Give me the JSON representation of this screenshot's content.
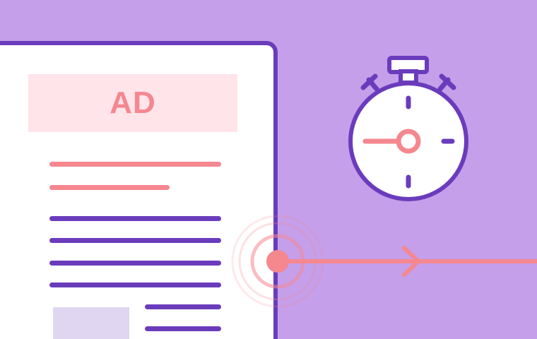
{
  "ad_banner": {
    "label": "AD"
  },
  "icons": {
    "stopwatch": "stopwatch-icon",
    "tracking_pulse": "pulse-target-icon",
    "direction_arrow": "arrow-right-icon"
  },
  "colors": {
    "background": "#c59fea",
    "outline_purple": "#6a3cbc",
    "accent_pink": "#f5878f",
    "ad_banner_fill": "#ffe4ea",
    "placeholder_fill": "#e0d6f1",
    "card_fill": "#ffffff"
  }
}
